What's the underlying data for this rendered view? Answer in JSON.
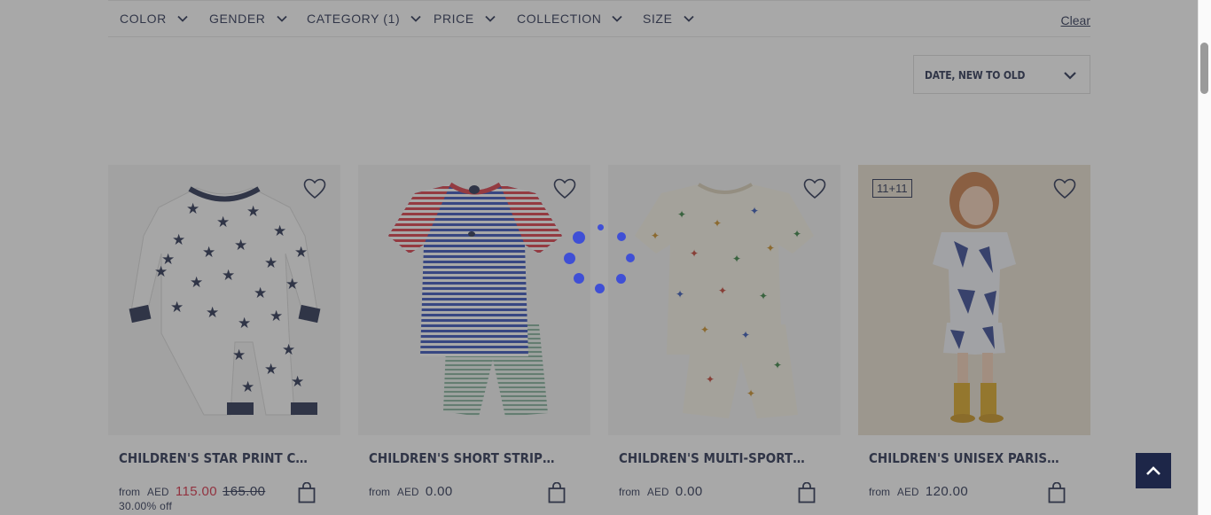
{
  "filters": {
    "color": "COLOR",
    "gender": "GENDER",
    "category": "CATEGORY (1)",
    "price": "PRICE",
    "collection": "COLLECTION",
    "size": "SIZE",
    "clear": "Clear"
  },
  "sort": {
    "selected": "DATE, NEW TO OLD"
  },
  "products": [
    {
      "title": "CHILDREN'S STAR PRINT COTTON...",
      "from": "from",
      "currency": "AED",
      "sale_price": "115.00",
      "original_price": "165.00",
      "discount": "30.00% off"
    },
    {
      "title": "CHILDREN'S SHORT STRIPY...",
      "from": "from",
      "currency": "AED",
      "price": "0.00"
    },
    {
      "title": "CHILDREN'S MULTI-SPORTS PRINT...",
      "from": "from",
      "currency": "AED",
      "price": "0.00"
    },
    {
      "title": "CHILDREN'S UNISEX PARIS COTTO...",
      "from": "from",
      "currency": "AED",
      "price": "120.00",
      "badge": "11+11"
    }
  ],
  "icons": {
    "filter_toggle": "chevron-down-icon",
    "wishlist": "heart-icon",
    "add_to_bag": "shopping-bag-icon",
    "back_to_top": "chevron-up-icon",
    "loading": "loading-spinner-icon"
  },
  "colors": {
    "navy": "#1d2648",
    "sale_red": "#d6223b",
    "spinner": "#3f4fd6",
    "overlay": "rgba(70,70,70,0.47)"
  }
}
